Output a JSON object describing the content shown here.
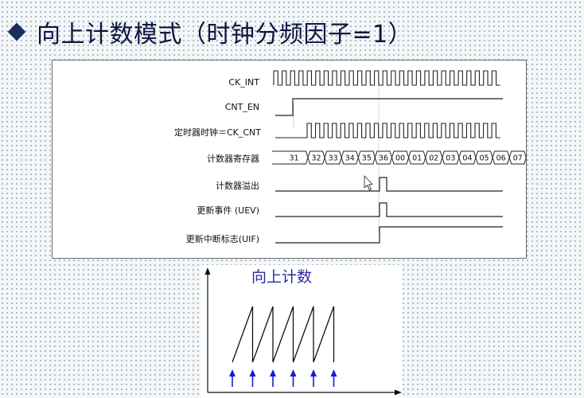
{
  "title": "向上计数模式（时钟分频因子=1）",
  "timing": {
    "signals": [
      {
        "label": "CK_INT"
      },
      {
        "label": "CNT_EN"
      },
      {
        "label": "定时器时钟＝CK_CNT"
      },
      {
        "label": "计数器寄存器"
      },
      {
        "label": "计数器溢出"
      },
      {
        "label": "更新事件 (UEV)"
      },
      {
        "label": "更新中断标志(UIF)"
      }
    ],
    "register_values": [
      "31",
      "32",
      "33",
      "34",
      "35",
      "36",
      "00",
      "01",
      "02",
      "03",
      "04",
      "05",
      "06",
      "07"
    ]
  },
  "counter_figure": {
    "title": "向上计数",
    "sawtooth_periods": 5,
    "arrow_count": 6,
    "arrow_color": "#1a1ad6"
  }
}
